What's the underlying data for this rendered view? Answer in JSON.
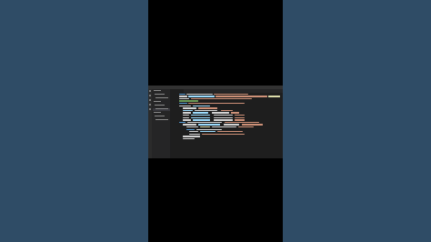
{
  "colors": {
    "background": "#2f4c66",
    "video_frame": "#000000",
    "editor_bg": "#1e1e1e",
    "keyword": "#569cd6",
    "string": "#ce9178",
    "function": "#dcdcaa",
    "variable": "#9cdcfe",
    "comment": "#6a9955",
    "plain": "#d4d4d4"
  },
  "editor": {
    "title": "",
    "tab_label": "",
    "explorer_rows": [
      "",
      "",
      "",
      "",
      "",
      "",
      "",
      "",
      ""
    ],
    "code_lines": [
      {
        "n": "",
        "segs": [
          [
            "keyword",
            2,
            8
          ],
          [
            "plain",
            11,
            30
          ],
          [
            "string",
            42,
            40
          ]
        ]
      },
      {
        "n": "",
        "segs": [
          [
            "plain",
            2,
            10
          ],
          [
            "variable",
            13,
            30
          ],
          [
            "string",
            44,
            60
          ],
          [
            "function",
            105,
            14
          ]
        ]
      },
      {
        "n": "",
        "segs": [
          [
            "plain",
            2,
            12
          ],
          [
            "string",
            16,
            70
          ]
        ]
      },
      {
        "n": "",
        "segs": [
          [
            "comment",
            2,
            22
          ]
        ]
      },
      {
        "n": "",
        "segs": [
          [
            "keyword",
            2,
            10
          ],
          [
            "string",
            13,
            65
          ]
        ]
      },
      {
        "n": "",
        "segs": [
          [
            "plain",
            2,
            14
          ],
          [
            "variable",
            18,
            20
          ]
        ]
      },
      {
        "n": "",
        "segs": [
          [
            "plain",
            6,
            16
          ],
          [
            "string",
            24,
            22
          ]
        ]
      },
      {
        "n": "",
        "segs": [
          [
            "variable",
            6,
            12
          ],
          [
            "plain",
            20,
            26
          ],
          [
            "string",
            50,
            14
          ]
        ]
      },
      {
        "n": "",
        "segs": [
          [
            "plain",
            6,
            10
          ],
          [
            "variable",
            18,
            18
          ],
          [
            "plain",
            40,
            20
          ],
          [
            "string",
            62,
            10
          ]
        ]
      },
      {
        "n": "",
        "segs": [
          [
            "plain",
            6,
            8
          ],
          [
            "variable",
            16,
            22
          ],
          [
            "plain",
            42,
            22
          ],
          [
            "string",
            66,
            12
          ]
        ]
      },
      {
        "n": "",
        "segs": [
          [
            "plain",
            6,
            8
          ],
          [
            "variable",
            16,
            22
          ],
          [
            "plain",
            42,
            22
          ],
          [
            "string",
            66,
            12
          ]
        ]
      },
      {
        "n": "",
        "segs": [
          [
            "plain",
            6,
            10
          ],
          [
            "variable",
            18,
            20
          ],
          [
            "plain",
            42,
            22
          ],
          [
            "string",
            66,
            12
          ]
        ]
      },
      {
        "n": "",
        "segs": [
          [
            "keyword",
            2,
            8
          ],
          [
            "plain",
            12,
            40
          ],
          [
            "string",
            55,
            40
          ]
        ]
      },
      {
        "n": "",
        "segs": [
          [
            "plain",
            6,
            16
          ],
          [
            "variable",
            24,
            26
          ],
          [
            "plain",
            54,
            18
          ],
          [
            "string",
            75,
            24
          ]
        ]
      },
      {
        "n": "",
        "segs": [
          [
            "plain",
            10,
            14
          ],
          [
            "function",
            26,
            12
          ],
          [
            "plain",
            40,
            28
          ],
          [
            "string",
            70,
            18
          ]
        ]
      },
      {
        "n": "",
        "segs": [
          [
            "keyword",
            10,
            10
          ],
          [
            "plain",
            22,
            30
          ]
        ]
      },
      {
        "n": "",
        "segs": [
          [
            "plain",
            14,
            10
          ],
          [
            "variable",
            26,
            18
          ],
          [
            "string",
            46,
            30
          ]
        ]
      },
      {
        "n": "",
        "segs": [
          [
            "plain",
            14,
            12
          ],
          [
            "string",
            28,
            50
          ]
        ]
      },
      {
        "n": "",
        "segs": [
          [
            "plain",
            6,
            20
          ]
        ]
      },
      {
        "n": "",
        "segs": [
          [
            "plain",
            6,
            14
          ]
        ]
      }
    ]
  }
}
